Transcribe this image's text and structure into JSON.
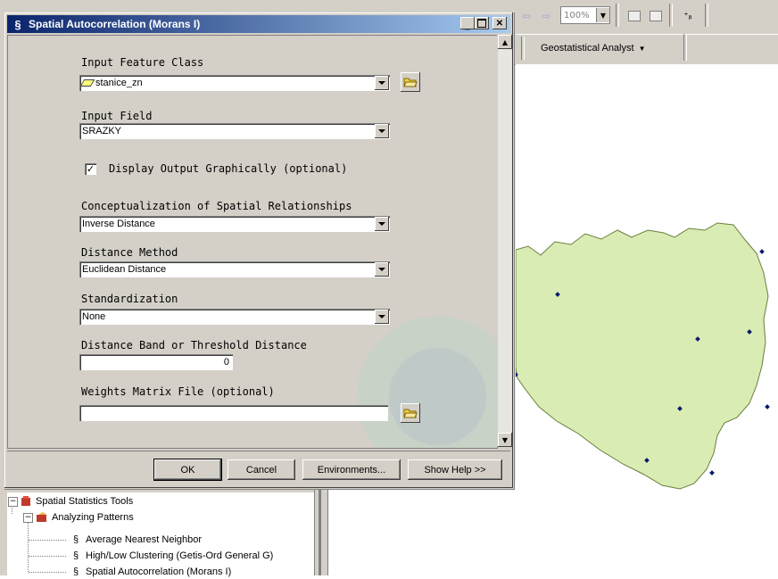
{
  "toolbar": {
    "zoom_value": "100%",
    "geo_label": "Geostatistical Analyst"
  },
  "dialog": {
    "title": "Spatial Autocorrelation (Morans I)",
    "fields": {
      "input_feature_class_label": "Input Feature Class",
      "input_feature_class_value": "stanice_zn",
      "input_field_label": "Input Field",
      "input_field_value": "SRAZKY",
      "display_output_label": "Display Output Graphically (optional)",
      "display_output_checked": true,
      "conceptualization_label": "Conceptualization of Spatial Relationships",
      "conceptualization_value": "Inverse Distance",
      "distance_method_label": "Distance Method",
      "distance_method_value": "Euclidean Distance",
      "standardization_label": "Standardization",
      "standardization_value": "None",
      "distance_band_label": "Distance Band or Threshold Distance",
      "distance_band_value": "0",
      "weights_matrix_label": "Weights Matrix File (optional)",
      "weights_matrix_value": ""
    },
    "buttons": {
      "ok": "OK",
      "cancel": "Cancel",
      "environments": "Environments...",
      "show_help": "Show Help >>"
    }
  },
  "tree": {
    "root": "Spatial Statistics Tools",
    "group": "Analyzing Patterns",
    "items": [
      "Average Nearest Neighbor",
      "High/Low Clustering (Getis-Ord General G)",
      "Spatial Autocorrelation (Morans I)"
    ]
  },
  "map": {
    "polygon_fill": "#d9ecb4",
    "point_color": "#0a1a6e"
  }
}
